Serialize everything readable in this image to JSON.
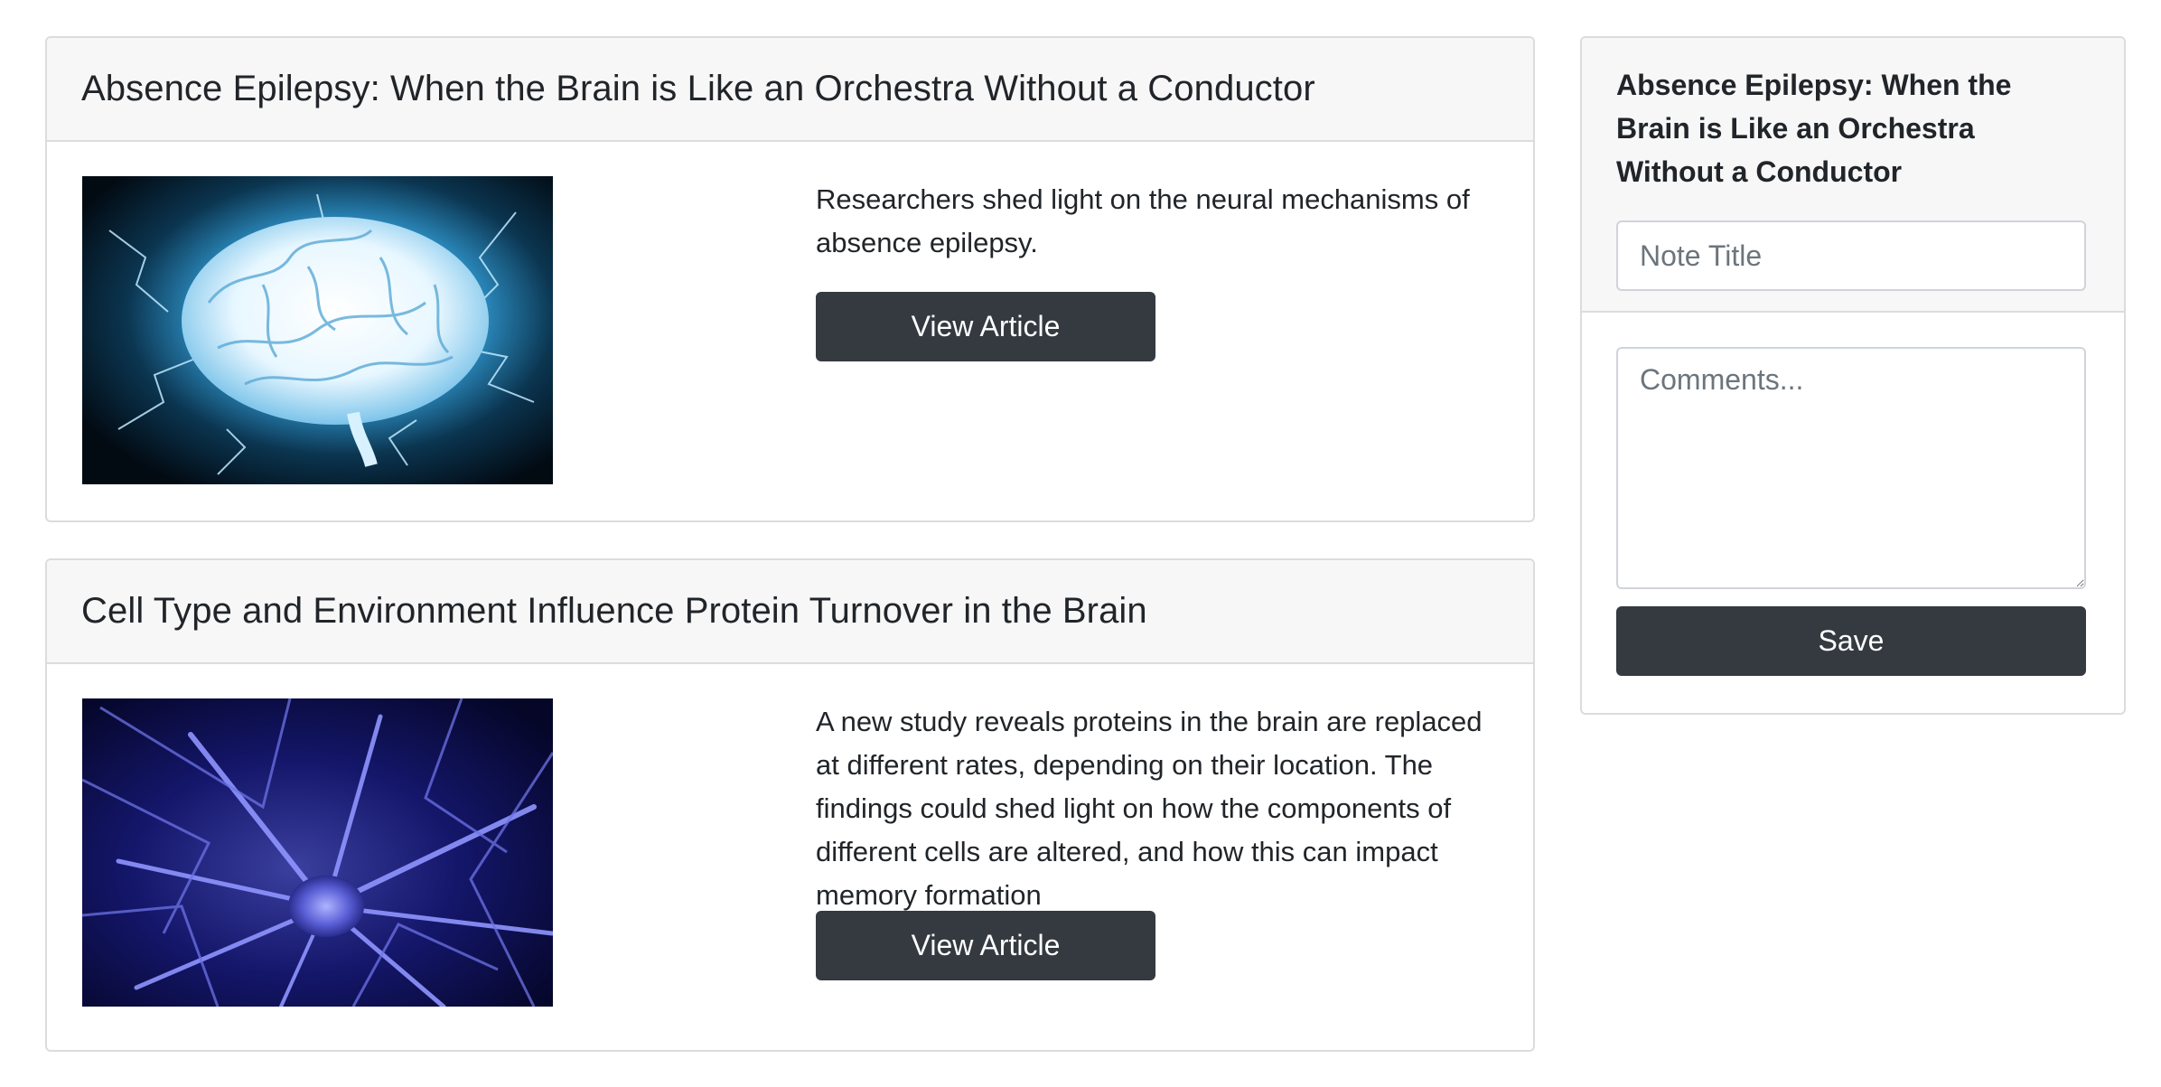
{
  "articles": [
    {
      "title": "Absence Epilepsy: When the Brain is Like an Orchestra Without a Conductor",
      "summary": "Researchers shed light on the neural mechanisms of absence epilepsy.",
      "button_label": "View Article",
      "image": "glowing-brain-image"
    },
    {
      "title": "Cell Type and Environment Influence Protein Turnover in the Brain",
      "summary": "A new study reveals proteins in the brain are replaced at different rates, depending on their location. The findings could shed light on how the components of different cells are altered, and how this can impact memory formation",
      "button_label": "View Article",
      "image": "neuron-network-image"
    }
  ],
  "note": {
    "heading": "Absence Epilepsy: When the Brain is Like an Orchestra Without a Conductor",
    "title_value": "",
    "title_placeholder": "Note Title",
    "comments_value": "",
    "comments_placeholder": "Comments...",
    "save_label": "Save"
  },
  "colors": {
    "button_bg": "#343a40",
    "card_header_bg": "#f7f7f7",
    "border": "#dcdcdc"
  }
}
